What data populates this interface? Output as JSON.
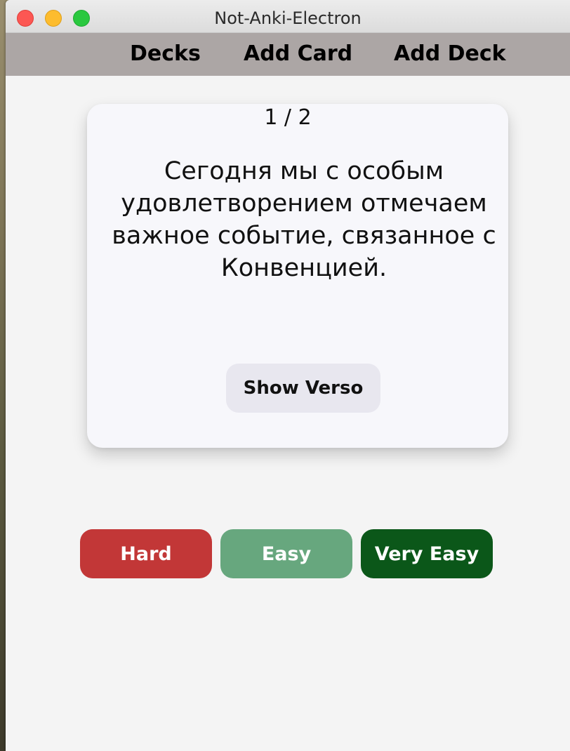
{
  "window": {
    "title": "Not-Anki-Electron"
  },
  "nav": {
    "items": [
      {
        "label": "Decks"
      },
      {
        "label": "Add Card"
      },
      {
        "label": "Add Deck"
      }
    ]
  },
  "card": {
    "counter": "1 / 2",
    "recto": "Сегодня мы с особым удовлетворением отмечаем важное событие, связанное с Конвенцией.",
    "show_verso_label": "Show Verso"
  },
  "rating": {
    "hard_label": "Hard",
    "easy_label": "Easy",
    "very_easy_label": "Very Easy"
  },
  "colors": {
    "nav_background": "#aca6a5",
    "card_background": "#f7f7fb",
    "hard": "#c23737",
    "easy": "#67a77e",
    "very_easy": "#0b5719"
  },
  "icons": {
    "close": "close-traffic-light",
    "minimize": "minimize-traffic-light",
    "maximize": "maximize-traffic-light"
  }
}
